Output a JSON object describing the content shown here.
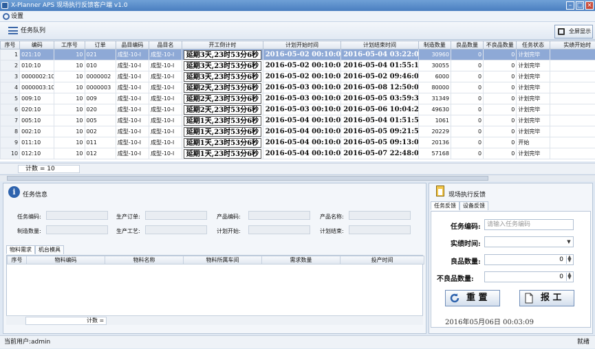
{
  "window": {
    "title": "X-Planner APS 现场执行反馈客户端 v1.0"
  },
  "menu": {
    "settings": "设置"
  },
  "queue": {
    "title": "任务队列",
    "fullscreen": "全屏显示"
  },
  "grid": {
    "columns": [
      "序号",
      "编码",
      "工序号",
      "订单",
      "品目编码",
      "品目名",
      "开工倒计时",
      "计划开始时间",
      "计划结束时间",
      "制造数量",
      "良品数量",
      "不良品数量",
      "任务状态",
      "实绩开始时"
    ],
    "rows": [
      [
        "1",
        "021:10",
        "10",
        "021",
        "成型-10-I",
        "成型-10-I",
        "延期3天,23时53分6秒",
        "2016-05-02 00:10:00",
        "2016-05-04 03:22:09",
        "30960",
        "0",
        "0",
        "计划完毕"
      ],
      [
        "2",
        "010:10",
        "10",
        "010",
        "成型-10-I",
        "成型-10-I",
        "延期3天,23时53分6秒",
        "2016-05-02 00:10:00",
        "2016-05-04 01:55:16",
        "30055",
        "0",
        "0",
        "计划完毕"
      ],
      [
        "3",
        "0000002:10",
        "10",
        "0000002",
        "成型-10-I",
        "成型-10-I",
        "延期3天,23时53分6秒",
        "2016-05-02 00:10:00",
        "2016-05-02 09:46:00",
        "6000",
        "0",
        "0",
        "计划完毕"
      ],
      [
        "4",
        "0000003:10",
        "10",
        "0000003",
        "成型-10-I",
        "成型-10-I",
        "延期2天,23时53分6秒",
        "2016-05-03 00:10:00",
        "2016-05-08 12:50:00",
        "80000",
        "0",
        "0",
        "计划完毕"
      ],
      [
        "5",
        "009:10",
        "10",
        "009",
        "成型-10-I",
        "成型-10-I",
        "延期2天,23时53分6秒",
        "2016-05-03 00:10:00",
        "2016-05-05 03:59:30",
        "31349",
        "0",
        "0",
        "计划完毕"
      ],
      [
        "6",
        "020:10",
        "10",
        "020",
        "成型-10-I",
        "成型-10-I",
        "延期2天,23时53分6秒",
        "2016-05-03 00:10:00",
        "2016-05-06 10:04:28",
        "49630",
        "0",
        "0",
        "计划完毕"
      ],
      [
        "7",
        "005:10",
        "10",
        "005",
        "成型-10-I",
        "成型-10-I",
        "延期1天,23时53分6秒",
        "2016-05-04 00:10:00",
        "2016-05-04 01:51:51",
        "1061",
        "0",
        "0",
        "计划完毕"
      ],
      [
        "8",
        "002:10",
        "10",
        "002",
        "成型-10-I",
        "成型-10-I",
        "延期1天,23时53分6秒",
        "2016-05-04 00:10:00",
        "2016-05-05 09:21:59",
        "20229",
        "0",
        "0",
        "计划完毕"
      ],
      [
        "9",
        "011:10",
        "10",
        "011",
        "成型-10-I",
        "成型-10-I",
        "延期1天,23时53分6秒",
        "2016-05-04 00:10:00",
        "2016-05-05 09:13:03",
        "20136",
        "0",
        "0",
        "开始"
      ],
      [
        "10",
        "012:10",
        "10",
        "012",
        "成型-10-I",
        "成型-10-I",
        "延期1天,23时53分6秒",
        "2016-05-04 00:10:00",
        "2016-05-07 22:48:07",
        "57168",
        "0",
        "0",
        "计划完毕"
      ]
    ],
    "count": "计数 = 10"
  },
  "taskinfo": {
    "title": "任务信息",
    "labels": [
      "任务编码:",
      "生产订单:",
      "产品编码:",
      "产品名称:",
      "制造数量:",
      "生产工艺:",
      "计划开始:",
      "计划结束:"
    ]
  },
  "material": {
    "tabs": [
      "物料需求",
      "机台模具"
    ],
    "columns": [
      "序号",
      "物料编码",
      "物料名称",
      "物料所属车间",
      "需求数量",
      "投产时间"
    ],
    "count": "计数 ="
  },
  "feedback": {
    "title": "现场执行反馈",
    "tabs": [
      "任务反馈",
      "设备反馈"
    ],
    "task_code_label": "任务编码:",
    "task_code_placeholder": "请输入任务编码",
    "actual_time_label": "实绩时间:",
    "good_qty_label": "良品数量:",
    "good_qty": "0",
    "bad_qty_label": "不良品数量:",
    "bad_qty": "0",
    "reset": "重 置",
    "report": "报 工",
    "clock": "2016年05月06日 00:03:09"
  },
  "status": {
    "user": "当前用户:admin",
    "state": "就绪"
  }
}
